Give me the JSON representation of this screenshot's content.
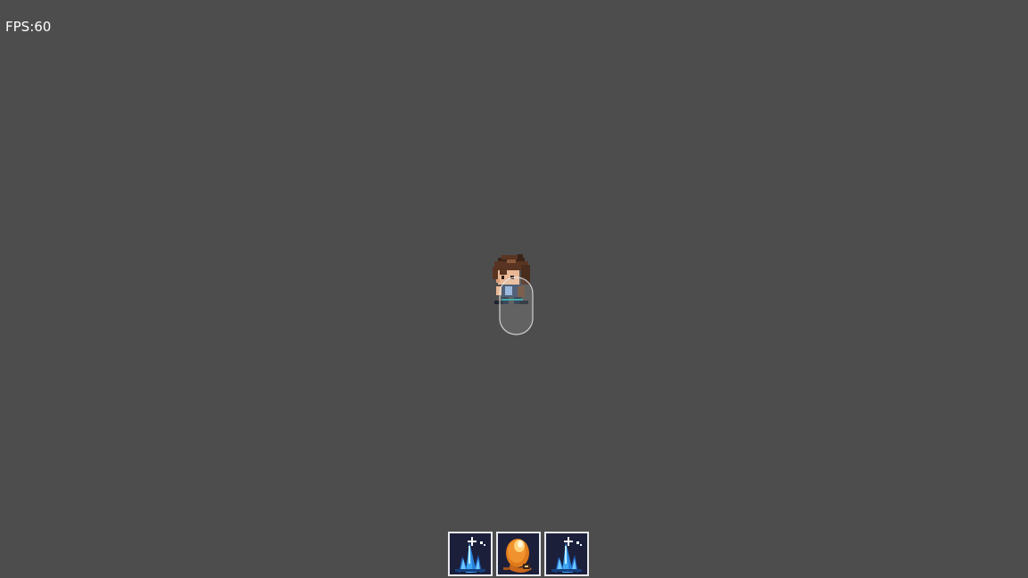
{
  "hud": {
    "fps_label": "FPS:60"
  },
  "hotbar": {
    "slots": [
      {
        "item": "blue-crystal-icon"
      },
      {
        "item": "orange-orb-icon"
      },
      {
        "item": "blue-crystal-icon"
      }
    ]
  },
  "colors": {
    "background": "#4d4d4d",
    "slot_background": "#1b1f3a",
    "slot_border": "#e8e8f0",
    "crystal": "#3fa9f5",
    "orb": "#f0922e"
  }
}
